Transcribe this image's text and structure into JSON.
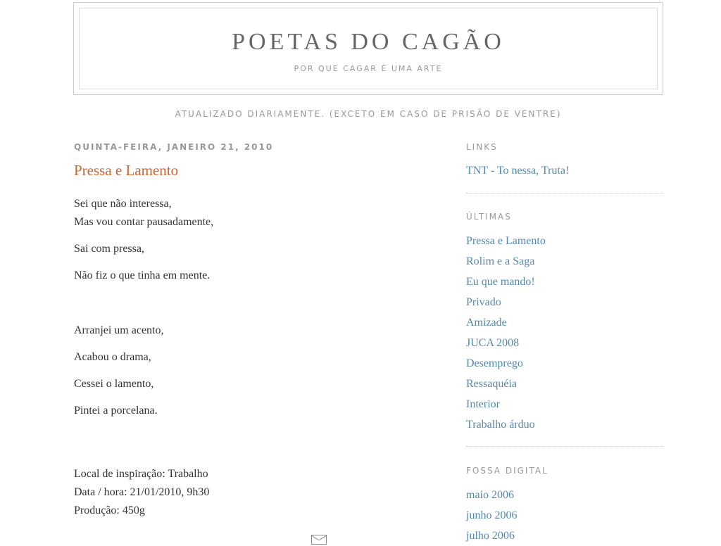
{
  "header": {
    "title": "POETAS DO CAGÃO",
    "subtitle": "POR QUE CAGAR É UMA ARTE"
  },
  "tagline": "ATUALIZADO DIARIAMENTE. (EXCETO EM CASO DE PRISÃO DE VENTRE)",
  "post": {
    "date": "QUINTA-FEIRA, JANEIRO 21, 2010",
    "title": "Pressa e Lamento",
    "lines": [
      "Sei que não interessa,",
      "Mas vou contar pausadamente,",
      "Sai com pressa,",
      "Não fiz o que tinha em mente.",
      "Arranjei um acento,",
      "Acabou o drama,",
      "Cessei o lamento,",
      "Pintei a porcelana.",
      "Local de inspiração: Trabalho",
      "Data / hora: 21/01/2010, 9h30",
      "Produção: 450g"
    ]
  },
  "sidebar": {
    "links": {
      "heading": "LINKS",
      "items": [
        "TNT - To nessa, Truta!"
      ]
    },
    "ultimas": {
      "heading": "ÚLTIMAS",
      "items": [
        "Pressa e Lamento",
        "Rolim e a Saga",
        "Eu que mando!",
        "Privado",
        "Amizade",
        "JUCA 2008",
        "Desemprego",
        "Ressaquéia",
        "Interior",
        "Trabalho árduo"
      ]
    },
    "fossa": {
      "heading": "FOSSA DIGITAL",
      "items": [
        "maio 2006",
        "junho 2006",
        "julho 2006"
      ]
    }
  },
  "icons": {
    "email": "mail-icon"
  },
  "colors": {
    "post_title": "#cc6633",
    "link": "#5588aa",
    "muted": "#999999",
    "text": "#333333"
  }
}
